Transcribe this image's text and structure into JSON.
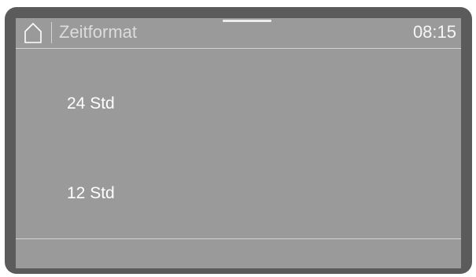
{
  "header": {
    "home_icon": "home-icon",
    "title": "Zeitformat",
    "clock": "08:15"
  },
  "options": [
    {
      "label": "24 Std"
    },
    {
      "label": "12 Std"
    }
  ],
  "colors": {
    "bezel": "#5b5b5b",
    "screen": "#9a9a9a",
    "text": "#ffffff",
    "title_text": "#dcdcdc",
    "divider": "#d3d3d3"
  }
}
